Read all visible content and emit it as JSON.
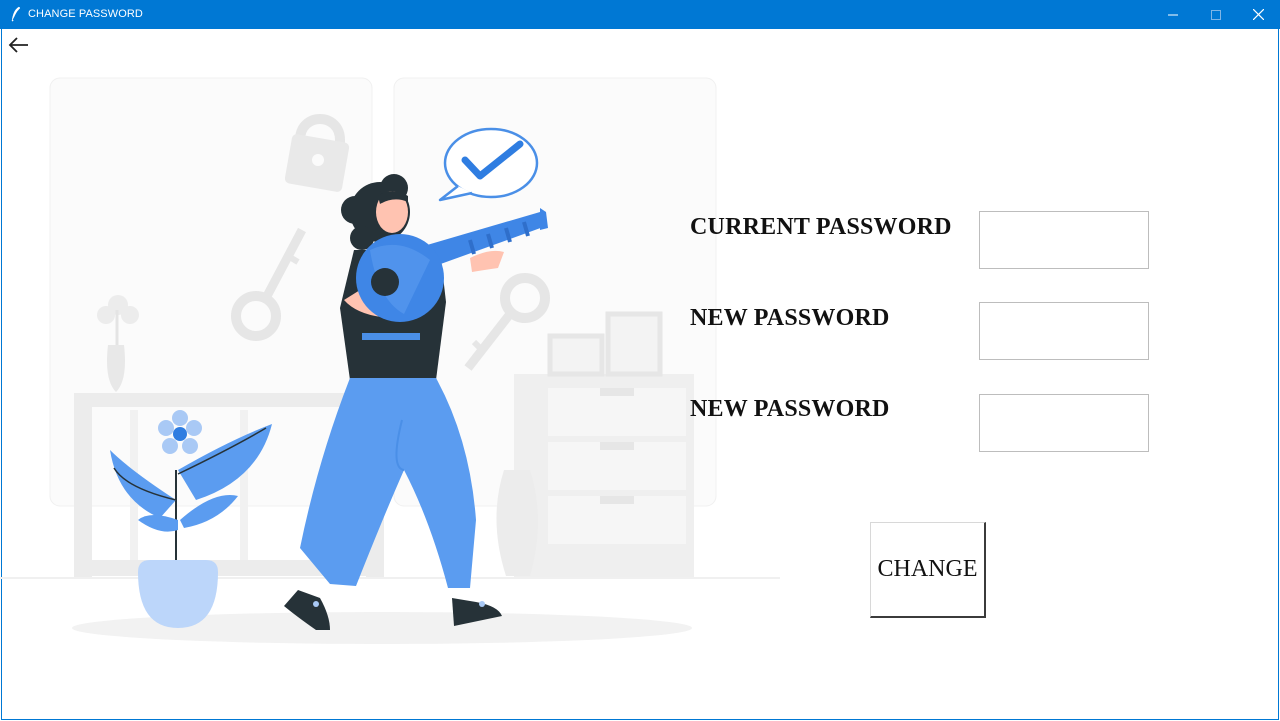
{
  "window": {
    "title": "CHANGE PASSWORD",
    "icon": "feather-icon"
  },
  "nav": {
    "back_icon": "back-arrow-icon"
  },
  "form": {
    "current_password_label": "CURRENT PASSWORD",
    "new_password_label": "NEW PASSWORD",
    "confirm_password_label": "NEW PASSWORD",
    "current_password_value": "",
    "new_password_value": "",
    "confirm_password_value": "",
    "change_button_label": "CHANGE"
  },
  "colors": {
    "titlebar": "#0078d4",
    "accent_blue": "#4a8fe7",
    "dark": "#263238"
  }
}
